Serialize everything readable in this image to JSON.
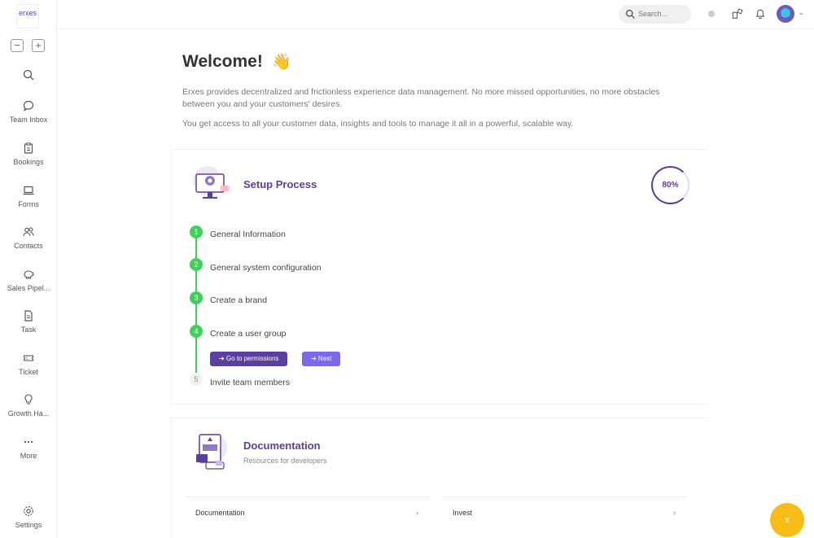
{
  "app": {
    "logo": "erxes"
  },
  "zoom": {
    "minus": "−",
    "plus": "+"
  },
  "sidebar": {
    "items": [
      {
        "label": "",
        "icon": "search-icon"
      },
      {
        "label": "Team Inbox",
        "icon": "chat-icon"
      },
      {
        "label": "Bookings",
        "icon": "clipboard-icon"
      },
      {
        "label": "Forms",
        "icon": "laptop-icon"
      },
      {
        "label": "Contacts",
        "icon": "users-icon"
      },
      {
        "label": "Sales Pipel...",
        "icon": "piggy-bank-icon"
      },
      {
        "label": "Task",
        "icon": "file-icon"
      },
      {
        "label": "Ticket",
        "icon": "ticket-icon"
      },
      {
        "label": "Growth Ha...",
        "icon": "bulb-icon"
      },
      {
        "label": "More",
        "icon": "more-icon"
      },
      {
        "label": "Settings",
        "icon": "gear-icon"
      }
    ]
  },
  "topbar": {
    "search_placeholder": "Search...",
    "caret": "⌄"
  },
  "welcome": {
    "title": "Welcome!",
    "wave": "👋",
    "paragraph1": "Erxes provides decentralized and frictionless experience data management. No more missed opportunities, no more obstacles between you and your customers' desires.",
    "paragraph2": "You get access to all your customer data, insights and tools to manage it all in a powerful, scalable way."
  },
  "setup": {
    "title": "Setup Process",
    "progress": "80%",
    "progress_value": 0.8,
    "steps": [
      {
        "num": "1",
        "label": "General Information",
        "done": true
      },
      {
        "num": "2",
        "label": "General system configuration",
        "done": true
      },
      {
        "num": "3",
        "label": "Create a brand",
        "done": true
      },
      {
        "num": "4",
        "label": "Create a user group",
        "done": true
      },
      {
        "num": "5",
        "label": "Invite team members",
        "done": false
      }
    ],
    "btn_permissions": "➜  Go to permissions",
    "btn_next": "➜  Next"
  },
  "documentation": {
    "title": "Documentation",
    "subtitle": "Resources for developers",
    "links": [
      {
        "label": "Documentation",
        "chev": "›"
      },
      {
        "label": "Invest",
        "chev": "›"
      }
    ]
  },
  "fab": {
    "label": "x"
  },
  "colors": {
    "brand": "#5b3fa0",
    "success": "#3fd05a",
    "accent": "#7b68ee",
    "fab": "#f7bd16"
  }
}
